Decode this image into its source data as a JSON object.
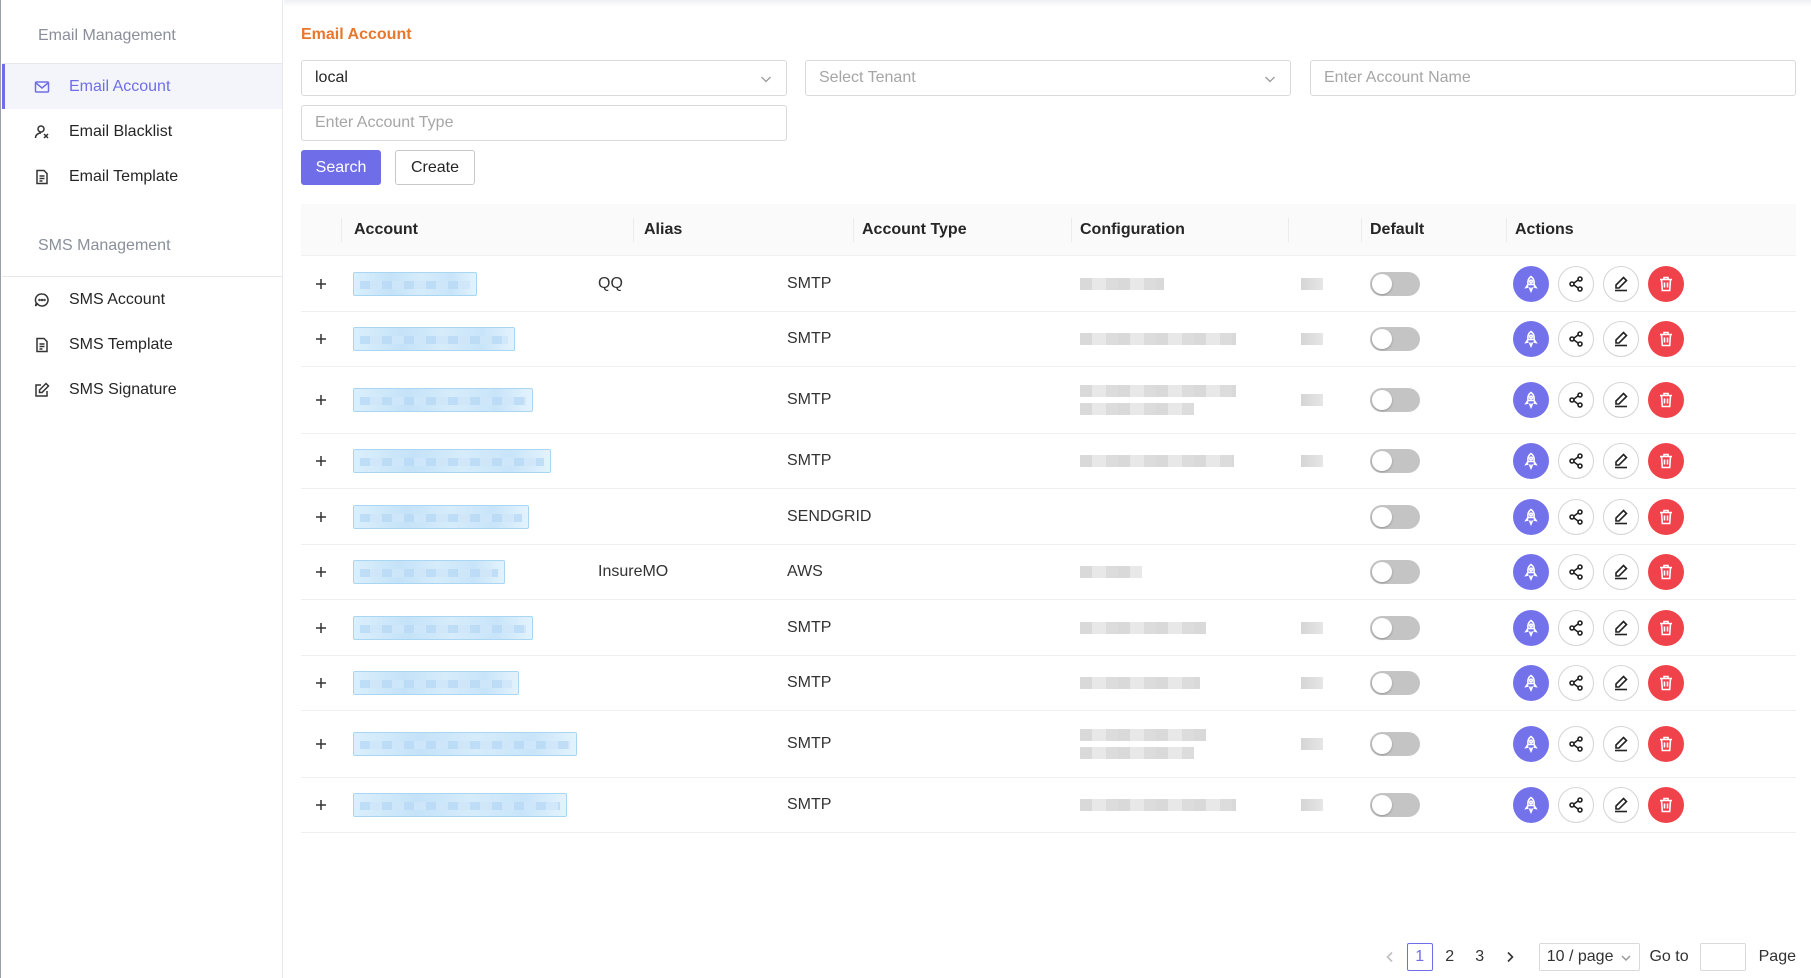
{
  "sidebar": {
    "groups": [
      {
        "title": "Email Management",
        "items": [
          {
            "label": "Email Account",
            "icon": "mail-icon",
            "active": true
          },
          {
            "label": "Email Blacklist",
            "icon": "user-block-icon",
            "active": false
          },
          {
            "label": "Email Template",
            "icon": "document-icon",
            "active": false
          }
        ]
      },
      {
        "title": "SMS Management",
        "items": [
          {
            "label": "SMS Account",
            "icon": "chat-icon",
            "active": false
          },
          {
            "label": "SMS Template",
            "icon": "document-icon",
            "active": false
          },
          {
            "label": "SMS Signature",
            "icon": "edit-square-icon",
            "active": false
          }
        ]
      }
    ]
  },
  "page": {
    "title": "Email Account"
  },
  "filters": {
    "environment_value": "local",
    "tenant_placeholder": "Select Tenant",
    "account_name_placeholder": "Enter Account Name",
    "account_type_placeholder": "Enter Account Type",
    "search_label": "Search",
    "create_label": "Create"
  },
  "table": {
    "columns": [
      "Account",
      "Alias",
      "Account Type",
      "Configuration",
      "",
      "Default",
      "Actions"
    ],
    "rows": [
      {
        "alias": "QQ",
        "type": "SMTP",
        "default": false
      },
      {
        "alias": "",
        "type": "SMTP",
        "default": false
      },
      {
        "alias": "",
        "type": "SMTP",
        "default": false
      },
      {
        "alias": "",
        "type": "SMTP",
        "default": false
      },
      {
        "alias": "",
        "type": "SENDGRID",
        "default": false
      },
      {
        "alias": "InsureMO",
        "type": "AWS",
        "default": false
      },
      {
        "alias": "",
        "type": "SMTP",
        "default": false
      },
      {
        "alias": "",
        "type": "SMTP",
        "default": false
      },
      {
        "alias": "",
        "type": "SMTP",
        "default": false
      },
      {
        "alias": "",
        "type": "SMTP",
        "default": false
      }
    ],
    "row_actions": [
      "rocket-icon",
      "share-icon",
      "edit-icon",
      "trash-icon"
    ]
  },
  "pagination": {
    "pages": [
      "1",
      "2",
      "3"
    ],
    "current": "1",
    "page_size": "10 / page",
    "goto_label": "Go to",
    "page_label": "Page"
  },
  "colors": {
    "accent": "#6f6ee8",
    "title_orange": "#e8772e",
    "danger": "#f0424a"
  }
}
